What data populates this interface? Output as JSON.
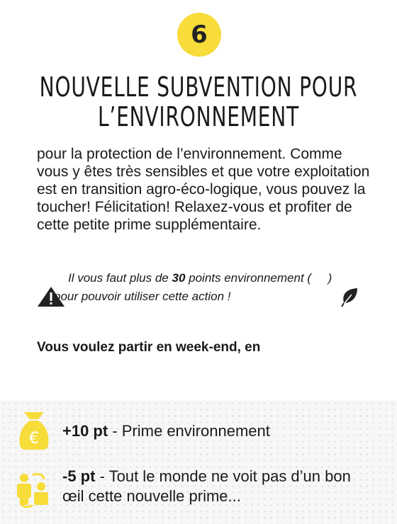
{
  "card": {
    "number": "6",
    "title_line1": "Nouvelle subvention pour",
    "title_line2": "l’environnement"
  },
  "body": "pour la protection de l’environnement. Comme vous y êtes très sensibles et que votre exploitation est en transition agro-éco-logique, vous pouvez la toucher! Félicitation! Relaxez-vous et profiter de cette petite prime supplémentaire.",
  "note": {
    "before": "Il vous faut plus de ",
    "value": "30",
    "after": " points environnement (     )",
    "line2": "pour pouvoir utiliser cette action !"
  },
  "question": "Vous voulez partir en week-end, en",
  "effects": [
    {
      "points": "+10 pt",
      "text": " - Prime environnement"
    },
    {
      "points": "-5 pt",
      "text": " - Tout le monde ne voit pas d’un bon œil cette nouvelle prime..."
    }
  ],
  "colors": {
    "accent": "#f7dc3a"
  }
}
